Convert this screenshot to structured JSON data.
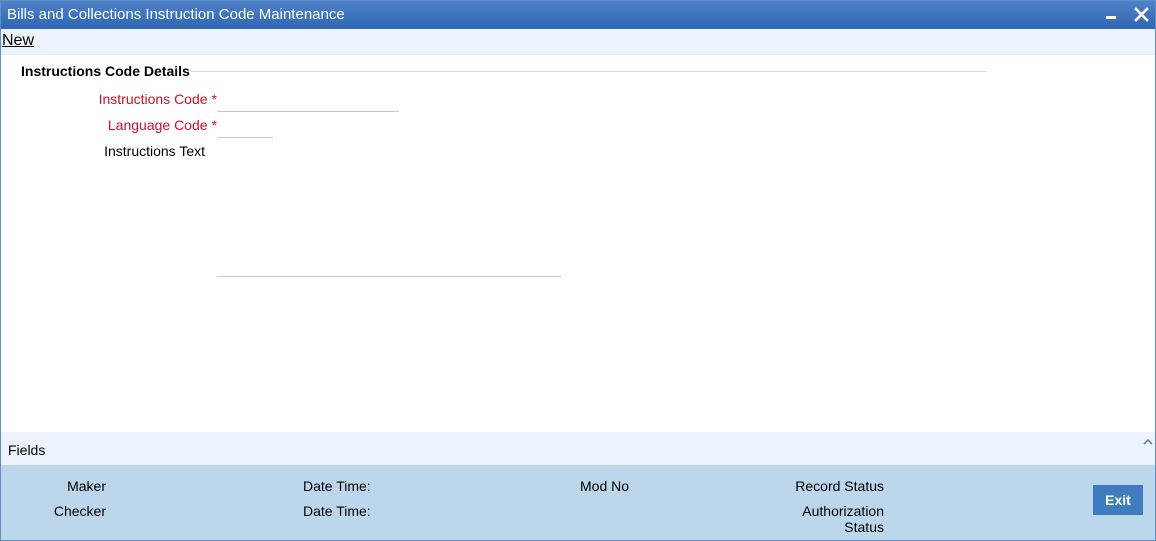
{
  "window": {
    "title": "Bills and Collections Instruction Code Maintenance",
    "minimize_icon": "minimize-icon",
    "close_icon": "close-icon"
  },
  "menu": {
    "new_label": "New"
  },
  "section": {
    "title": "Instructions Code Details"
  },
  "form": {
    "instructions_code": {
      "label": "Instructions Code",
      "required": "*",
      "value": ""
    },
    "language_code": {
      "label": "Language Code",
      "required": "*",
      "value": ""
    },
    "instructions_text": {
      "label": "Instructions Text",
      "value": ""
    }
  },
  "fields_bar": {
    "label": "Fields",
    "toggle_icon": "chevron-up-icon"
  },
  "footer": {
    "maker": "Maker",
    "checker": "Checker",
    "date_time_1": "Date Time:",
    "date_time_2": "Date Time:",
    "mod_no": "Mod No",
    "record_status": "Record Status",
    "authorization_status_line1": "Authorization",
    "authorization_status_line2": "Status",
    "exit_label": "Exit"
  },
  "colors": {
    "titlebar": "#2f65b3",
    "required": "#c8102e",
    "footer_bg": "#bcd6ec",
    "exit_button": "#3f7bbf"
  }
}
